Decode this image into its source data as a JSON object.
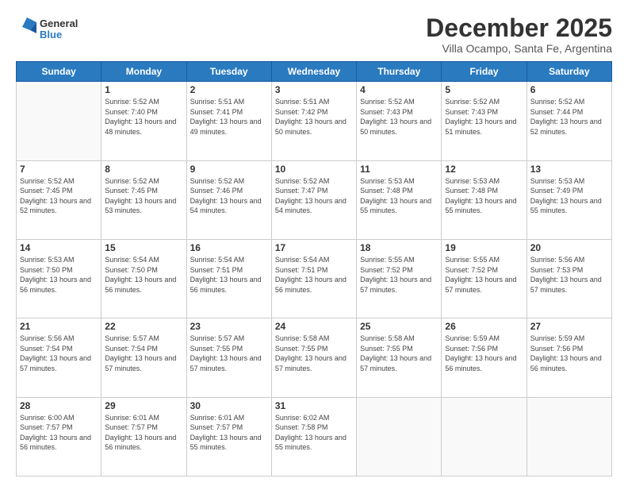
{
  "logo": {
    "line1": "General",
    "line2": "Blue"
  },
  "header": {
    "title": "December 2025",
    "subtitle": "Villa Ocampo, Santa Fe, Argentina"
  },
  "weekdays": [
    "Sunday",
    "Monday",
    "Tuesday",
    "Wednesday",
    "Thursday",
    "Friday",
    "Saturday"
  ],
  "weeks": [
    [
      {
        "day": "",
        "empty": true
      },
      {
        "day": "1",
        "sunrise": "Sunrise: 5:52 AM",
        "sunset": "Sunset: 7:40 PM",
        "daylight": "Daylight: 13 hours and 48 minutes."
      },
      {
        "day": "2",
        "sunrise": "Sunrise: 5:51 AM",
        "sunset": "Sunset: 7:41 PM",
        "daylight": "Daylight: 13 hours and 49 minutes."
      },
      {
        "day": "3",
        "sunrise": "Sunrise: 5:51 AM",
        "sunset": "Sunset: 7:42 PM",
        "daylight": "Daylight: 13 hours and 50 minutes."
      },
      {
        "day": "4",
        "sunrise": "Sunrise: 5:52 AM",
        "sunset": "Sunset: 7:43 PM",
        "daylight": "Daylight: 13 hours and 50 minutes."
      },
      {
        "day": "5",
        "sunrise": "Sunrise: 5:52 AM",
        "sunset": "Sunset: 7:43 PM",
        "daylight": "Daylight: 13 hours and 51 minutes."
      },
      {
        "day": "6",
        "sunrise": "Sunrise: 5:52 AM",
        "sunset": "Sunset: 7:44 PM",
        "daylight": "Daylight: 13 hours and 52 minutes."
      }
    ],
    [
      {
        "day": "7",
        "sunrise": "Sunrise: 5:52 AM",
        "sunset": "Sunset: 7:45 PM",
        "daylight": "Daylight: 13 hours and 52 minutes."
      },
      {
        "day": "8",
        "sunrise": "Sunrise: 5:52 AM",
        "sunset": "Sunset: 7:45 PM",
        "daylight": "Daylight: 13 hours and 53 minutes."
      },
      {
        "day": "9",
        "sunrise": "Sunrise: 5:52 AM",
        "sunset": "Sunset: 7:46 PM",
        "daylight": "Daylight: 13 hours and 54 minutes."
      },
      {
        "day": "10",
        "sunrise": "Sunrise: 5:52 AM",
        "sunset": "Sunset: 7:47 PM",
        "daylight": "Daylight: 13 hours and 54 minutes."
      },
      {
        "day": "11",
        "sunrise": "Sunrise: 5:53 AM",
        "sunset": "Sunset: 7:48 PM",
        "daylight": "Daylight: 13 hours and 55 minutes."
      },
      {
        "day": "12",
        "sunrise": "Sunrise: 5:53 AM",
        "sunset": "Sunset: 7:48 PM",
        "daylight": "Daylight: 13 hours and 55 minutes."
      },
      {
        "day": "13",
        "sunrise": "Sunrise: 5:53 AM",
        "sunset": "Sunset: 7:49 PM",
        "daylight": "Daylight: 13 hours and 55 minutes."
      }
    ],
    [
      {
        "day": "14",
        "sunrise": "Sunrise: 5:53 AM",
        "sunset": "Sunset: 7:50 PM",
        "daylight": "Daylight: 13 hours and 56 minutes."
      },
      {
        "day": "15",
        "sunrise": "Sunrise: 5:54 AM",
        "sunset": "Sunset: 7:50 PM",
        "daylight": "Daylight: 13 hours and 56 minutes."
      },
      {
        "day": "16",
        "sunrise": "Sunrise: 5:54 AM",
        "sunset": "Sunset: 7:51 PM",
        "daylight": "Daylight: 13 hours and 56 minutes."
      },
      {
        "day": "17",
        "sunrise": "Sunrise: 5:54 AM",
        "sunset": "Sunset: 7:51 PM",
        "daylight": "Daylight: 13 hours and 56 minutes."
      },
      {
        "day": "18",
        "sunrise": "Sunrise: 5:55 AM",
        "sunset": "Sunset: 7:52 PM",
        "daylight": "Daylight: 13 hours and 57 minutes."
      },
      {
        "day": "19",
        "sunrise": "Sunrise: 5:55 AM",
        "sunset": "Sunset: 7:52 PM",
        "daylight": "Daylight: 13 hours and 57 minutes."
      },
      {
        "day": "20",
        "sunrise": "Sunrise: 5:56 AM",
        "sunset": "Sunset: 7:53 PM",
        "daylight": "Daylight: 13 hours and 57 minutes."
      }
    ],
    [
      {
        "day": "21",
        "sunrise": "Sunrise: 5:56 AM",
        "sunset": "Sunset: 7:54 PM",
        "daylight": "Daylight: 13 hours and 57 minutes."
      },
      {
        "day": "22",
        "sunrise": "Sunrise: 5:57 AM",
        "sunset": "Sunset: 7:54 PM",
        "daylight": "Daylight: 13 hours and 57 minutes."
      },
      {
        "day": "23",
        "sunrise": "Sunrise: 5:57 AM",
        "sunset": "Sunset: 7:55 PM",
        "daylight": "Daylight: 13 hours and 57 minutes."
      },
      {
        "day": "24",
        "sunrise": "Sunrise: 5:58 AM",
        "sunset": "Sunset: 7:55 PM",
        "daylight": "Daylight: 13 hours and 57 minutes."
      },
      {
        "day": "25",
        "sunrise": "Sunrise: 5:58 AM",
        "sunset": "Sunset: 7:55 PM",
        "daylight": "Daylight: 13 hours and 57 minutes."
      },
      {
        "day": "26",
        "sunrise": "Sunrise: 5:59 AM",
        "sunset": "Sunset: 7:56 PM",
        "daylight": "Daylight: 13 hours and 56 minutes."
      },
      {
        "day": "27",
        "sunrise": "Sunrise: 5:59 AM",
        "sunset": "Sunset: 7:56 PM",
        "daylight": "Daylight: 13 hours and 56 minutes."
      }
    ],
    [
      {
        "day": "28",
        "sunrise": "Sunrise: 6:00 AM",
        "sunset": "Sunset: 7:57 PM",
        "daylight": "Daylight: 13 hours and 56 minutes."
      },
      {
        "day": "29",
        "sunrise": "Sunrise: 6:01 AM",
        "sunset": "Sunset: 7:57 PM",
        "daylight": "Daylight: 13 hours and 56 minutes."
      },
      {
        "day": "30",
        "sunrise": "Sunrise: 6:01 AM",
        "sunset": "Sunset: 7:57 PM",
        "daylight": "Daylight: 13 hours and 55 minutes."
      },
      {
        "day": "31",
        "sunrise": "Sunrise: 6:02 AM",
        "sunset": "Sunset: 7:58 PM",
        "daylight": "Daylight: 13 hours and 55 minutes."
      },
      {
        "day": "",
        "empty": true
      },
      {
        "day": "",
        "empty": true
      },
      {
        "day": "",
        "empty": true
      }
    ]
  ]
}
